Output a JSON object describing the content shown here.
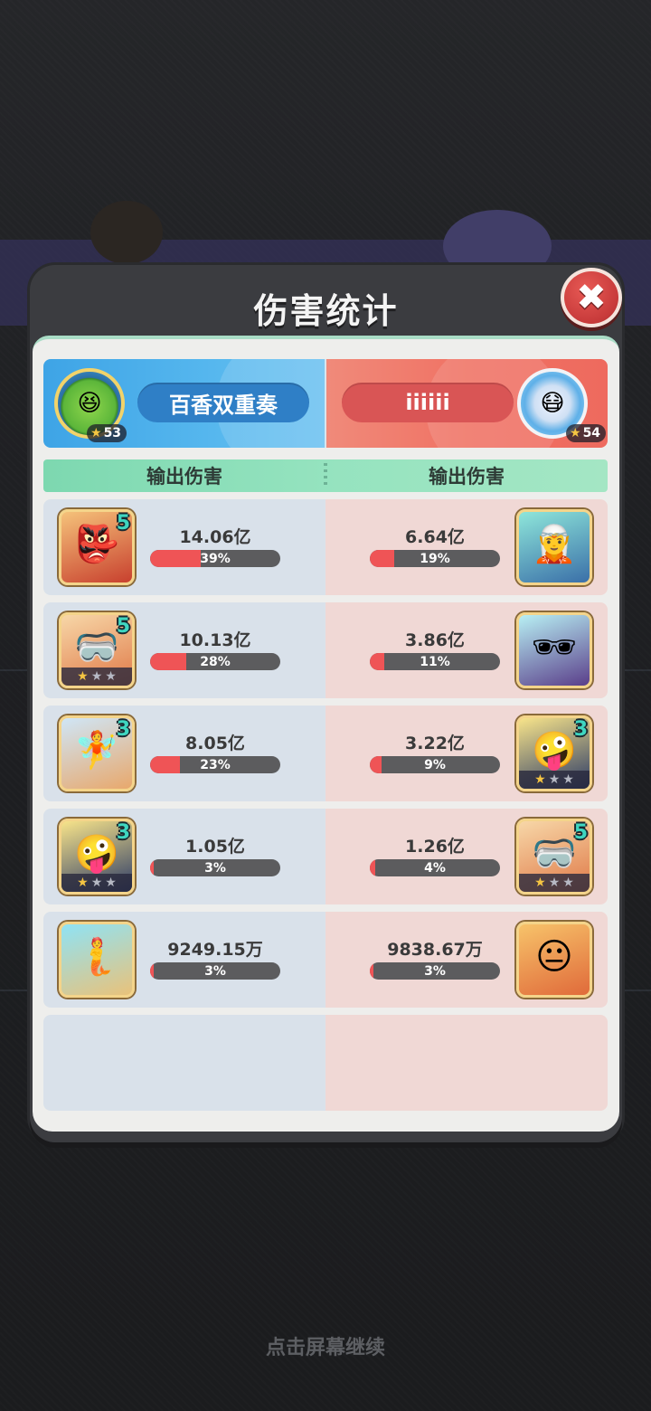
{
  "modal": {
    "title": "伤害统计"
  },
  "close_icon_glyph": "✖",
  "teams": {
    "left": {
      "name": "百香双重奏",
      "level": "53",
      "color": "#3ea4e6"
    },
    "right": {
      "name": "iiiiii",
      "level": "54",
      "color": "#f07264"
    }
  },
  "columns": {
    "left": "输出伤害",
    "right": "输出伤害"
  },
  "rows": [
    {
      "left": {
        "hero_icon": "hero-red-hair-warrior-icon",
        "hero_level": "5",
        "stars": 0,
        "damage": "14.06亿",
        "pct_label": "39%",
        "pct": 0.39
      },
      "right": {
        "hero_icon": "hero-teal-hair-icon",
        "hero_level": "",
        "stars": 0,
        "damage": "6.64亿",
        "pct_label": "19%",
        "pct": 0.19
      }
    },
    {
      "left": {
        "hero_icon": "hero-visor-blonde-icon",
        "hero_level": "5",
        "stars": 1,
        "damage": "10.13亿",
        "pct_label": "28%",
        "pct": 0.28
      },
      "right": {
        "hero_icon": "hero-cyber-visor-icon",
        "hero_level": "",
        "stars": 0,
        "damage": "3.86亿",
        "pct_label": "11%",
        "pct": 0.11
      }
    },
    {
      "left": {
        "hero_icon": "hero-silver-hair-girl-icon",
        "hero_level": "3",
        "stars": 0,
        "damage": "8.05亿",
        "pct_label": "23%",
        "pct": 0.23
      },
      "right": {
        "hero_icon": "hero-blonde-eyepatch-icon",
        "hero_level": "3",
        "stars": 1,
        "damage": "3.22亿",
        "pct_label": "9%",
        "pct": 0.09
      }
    },
    {
      "left": {
        "hero_icon": "hero-blonde-eyepatch-icon",
        "hero_level": "3",
        "stars": 1,
        "damage": "1.05亿",
        "pct_label": "3%",
        "pct": 0.03
      },
      "right": {
        "hero_icon": "hero-visor-blonde-icon",
        "hero_level": "5",
        "stars": 1,
        "damage": "1.26亿",
        "pct_label": "4%",
        "pct": 0.04
      }
    },
    {
      "left": {
        "hero_icon": "hero-blue-hair-girl-icon",
        "hero_level": "",
        "stars": 0,
        "damage": "9249.15万",
        "pct_label": "3%",
        "pct": 0.03
      },
      "right": {
        "hero_icon": "hero-goggles-pilot-icon",
        "hero_level": "",
        "stars": 0,
        "damage": "9838.67万",
        "pct_label": "3%",
        "pct": 0.03
      }
    }
  ],
  "footer": {
    "hint": "点击屏幕继续"
  }
}
